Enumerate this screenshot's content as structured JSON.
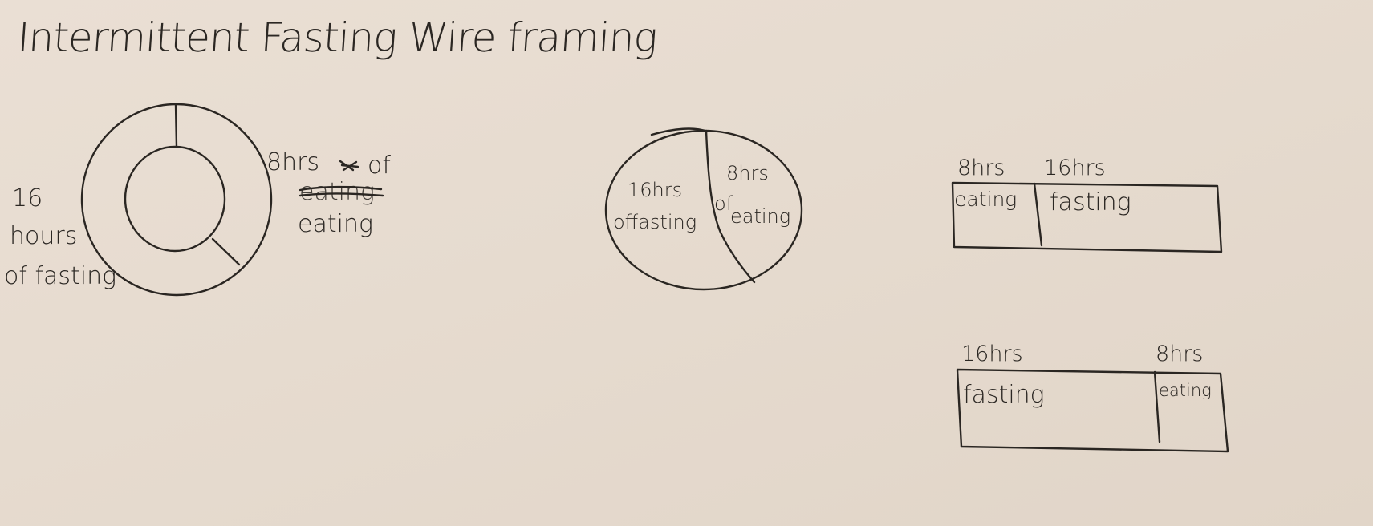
{
  "title": "Intermittent Fasting Wire framing",
  "donut": {
    "fasting_label": [
      "16",
      "hours",
      "of fasting"
    ],
    "eating_label_line1": "8hrs",
    "eating_label_scribble": "a",
    "eating_label_of": "of",
    "eating_label_crossed": "eating",
    "eating_label_line3": "eating"
  },
  "pie": {
    "fasting_label": [
      "16hrs",
      "offasting"
    ],
    "eating_label": [
      "8hrs",
      "of",
      "eating"
    ]
  },
  "bar_eating_first": {
    "head_left": "8hrs",
    "head_right": "16hrs",
    "cell_left": "eating",
    "cell_right": "fasting"
  },
  "bar_fasting_first": {
    "head_left": "16hrs",
    "head_right": "8hrs",
    "cell_left": "fasting",
    "cell_right": "eating"
  },
  "chart_data": [
    {
      "type": "pie",
      "style": "donut",
      "series": [
        {
          "label": "hours of fasting",
          "values": [
            16
          ]
        },
        {
          "label": "hrs of eating",
          "values": [
            8
          ]
        }
      ],
      "categories": [
        "fasting",
        "eating"
      ],
      "values": [
        16,
        8
      ]
    },
    {
      "type": "pie",
      "categories": [
        "fasting",
        "eating"
      ],
      "values": [
        16,
        8
      ]
    },
    {
      "type": "bar",
      "orientation": "horizontal-stacked",
      "categories": [
        "eating",
        "fasting"
      ],
      "values": [
        8,
        16
      ]
    },
    {
      "type": "bar",
      "orientation": "horizontal-stacked",
      "categories": [
        "fasting",
        "eating"
      ],
      "values": [
        16,
        8
      ]
    }
  ]
}
